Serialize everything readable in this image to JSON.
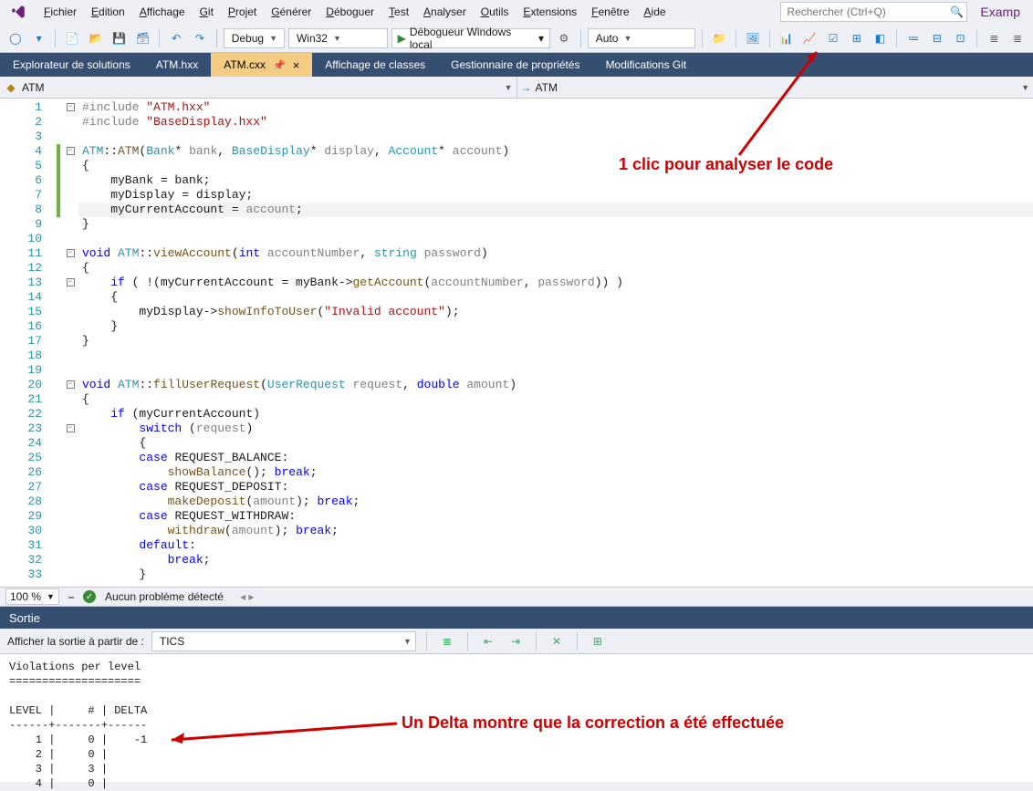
{
  "menu": [
    "Fichier",
    "Edition",
    "Affichage",
    "Git",
    "Projet",
    "Générer",
    "Déboguer",
    "Test",
    "Analyser",
    "Outils",
    "Extensions",
    "Fenêtre",
    "Aide"
  ],
  "search_placeholder": "Rechercher (Ctrl+Q)",
  "brand": "Examp",
  "config_combo": "Debug",
  "platform_combo": "Win32",
  "run_label": "Débogueur Windows local",
  "auto_combo": "Auto",
  "doctabs": [
    {
      "label": "Explorateur de solutions"
    },
    {
      "label": "ATM.hxx"
    },
    {
      "label": "ATM.cxx",
      "active": true,
      "pinned": true
    },
    {
      "label": "Affichage de classes"
    },
    {
      "label": "Gestionnaire de propriétés"
    },
    {
      "label": "Modifications Git"
    }
  ],
  "nav_left": "ATM",
  "nav_right": "ATM",
  "zoom": "100 %",
  "issue_status": "Aucun problème détecté",
  "output_title": "Sortie",
  "output_from_label": "Afficher la sortie à partir de :",
  "output_from_value": "TICS",
  "annotation1": "1 clic pour analyser le code",
  "annotation2": "Un Delta montre que la correction a été effectuée",
  "code_lines": [
    {
      "n": 1,
      "fold": "minus",
      "html": "<span class='gray'>#include </span><span class='str'>\"ATM.hxx\"</span>"
    },
    {
      "n": 2,
      "html": "<span class='gray'>#include </span><span class='str'>\"BaseDisplay.hxx\"</span>"
    },
    {
      "n": 3,
      "html": ""
    },
    {
      "n": 4,
      "mark": "green",
      "fold": "minus",
      "html": "<span class='typ'>ATM</span>::<span class='func'>ATM</span>(<span class='typ'>Bank</span>* <span class='gray'>bank</span>, <span class='typ'>BaseDisplay</span>* <span class='gray'>display</span>, <span class='typ'>Account</span>* <span class='gray'>account</span>)"
    },
    {
      "n": 5,
      "mark": "green",
      "html": "{"
    },
    {
      "n": 6,
      "mark": "green",
      "html": "    myBank = bank;"
    },
    {
      "n": 7,
      "mark": "green",
      "html": "    myDisplay = display;"
    },
    {
      "n": 8,
      "mark": "green",
      "hl": true,
      "html": "    myCurrentAccount = <span class='gray'>account</span>;"
    },
    {
      "n": 9,
      "html": "}"
    },
    {
      "n": 10,
      "html": ""
    },
    {
      "n": 11,
      "fold": "minus",
      "html": "<span class='kw'>void</span> <span class='typ'>ATM</span>::<span class='func'>viewAccount</span>(<span class='kw'>int</span> <span class='gray'>accountNumber</span>, <span class='typ'>string</span> <span class='gray'>password</span>)"
    },
    {
      "n": 12,
      "html": "{"
    },
    {
      "n": 13,
      "fold": "minus",
      "html": "    <span class='kw'>if</span> ( !(myCurrentAccount = myBank-&gt;<span class='func'>getAccount</span>(<span class='gray'>accountNumber</span>, <span class='gray'>password</span>)) )"
    },
    {
      "n": 14,
      "html": "    {"
    },
    {
      "n": 15,
      "html": "        myDisplay-&gt;<span class='func'>showInfoToUser</span>(<span class='str'>\"Invalid account\"</span>);"
    },
    {
      "n": 16,
      "html": "    }"
    },
    {
      "n": 17,
      "html": "}"
    },
    {
      "n": 18,
      "html": ""
    },
    {
      "n": 19,
      "html": ""
    },
    {
      "n": 20,
      "fold": "minus",
      "html": "<span class='kw'>void</span> <span class='typ'>ATM</span>::<span class='func'>fillUserRequest</span>(<span class='typ'>UserRequest</span> <span class='gray'>request</span>, <span class='kw'>double</span> <span class='gray'>amount</span>)"
    },
    {
      "n": 21,
      "html": "{"
    },
    {
      "n": 22,
      "html": "    <span class='kw'>if</span> (myCurrentAccount)"
    },
    {
      "n": 23,
      "fold": "minus",
      "html": "        <span class='kw'>switch</span> (<span class='gray'>request</span>)"
    },
    {
      "n": 24,
      "html": "        {"
    },
    {
      "n": 25,
      "html": "        <span class='kw'>case</span> REQUEST_BALANCE:"
    },
    {
      "n": 26,
      "html": "            <span class='func'>showBalance</span>(); <span class='kw'>break</span>;"
    },
    {
      "n": 27,
      "html": "        <span class='kw'>case</span> REQUEST_DEPOSIT:"
    },
    {
      "n": 28,
      "html": "            <span class='func'>makeDeposit</span>(<span class='gray'>amount</span>); <span class='kw'>break</span>;"
    },
    {
      "n": 29,
      "html": "        <span class='kw'>case</span> REQUEST_WITHDRAW:"
    },
    {
      "n": 30,
      "html": "            <span class='func'>withdraw</span>(<span class='gray'>amount</span>); <span class='kw'>break</span>;"
    },
    {
      "n": 31,
      "html": "        <span class='kw'>default</span>:"
    },
    {
      "n": 32,
      "html": "            <span class='kw'>break</span>;"
    },
    {
      "n": 33,
      "html": "        }"
    }
  ],
  "output_text": "Violations per level\n====================\n\nLEVEL |     # | DELTA\n------+-------+------\n    1 |     0 |    -1\n    2 |     0 |\n    3 |     3 |\n    4 |     0 |"
}
